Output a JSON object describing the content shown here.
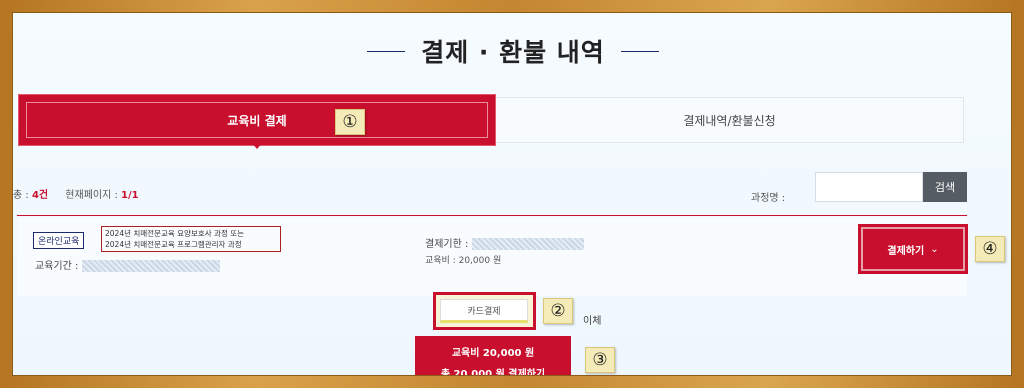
{
  "page": {
    "title": "결제 · 환불 내역"
  },
  "tabs": [
    {
      "label": "교육비 결제",
      "active": true
    },
    {
      "label": "결제내역/환불신청",
      "active": false
    }
  ],
  "markers": [
    "①",
    "②",
    "③",
    "④"
  ],
  "list_info": {
    "total_label": "총 :",
    "total_count": "4건",
    "page_label": "현재페이지 :",
    "page_value": "1/1"
  },
  "search": {
    "label": "과정명 :",
    "value": "",
    "button_label": "검색"
  },
  "course": {
    "badge": "온라인교육",
    "name_line1": "2024년 치매전문교육 요양보호사 과정 또는",
    "name_line2": "2024년 치매전문교육 프로그램관리자 과정",
    "period_label": "교육기간 :",
    "deadline_label": "결제기한 :",
    "fee_label": "교육비 :",
    "fee_value": "20,000 원",
    "pay_button": "결제하기",
    "pay_button_icon": "chevron-down-icon"
  },
  "payment": {
    "card_option": "카드결제",
    "transfer_option_partial": "이체",
    "summary_line1": "교육비 20,000 원",
    "summary_line2": "총 20,000 원 결제하기"
  },
  "colors": {
    "accent": "#c8102e",
    "navy": "#1b2a6b",
    "frame": "#c98d2e"
  }
}
